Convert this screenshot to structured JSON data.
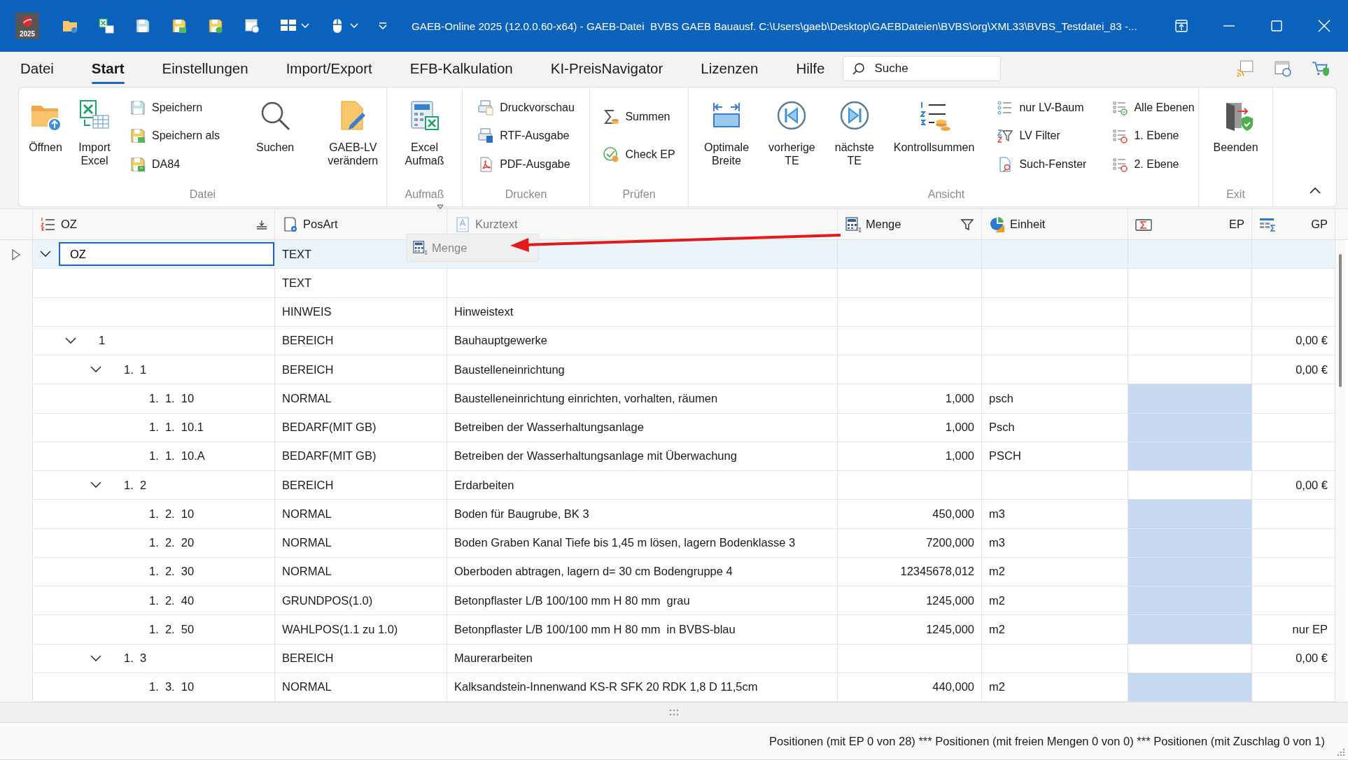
{
  "title_bar": {
    "app_icon_label": "2025",
    "title": "GAEB-Online 2025 (12.0.0.60-x64) - GAEB-Datei  BVBS GAEB Bauausf. C:\\Users\\gaeb\\Desktop\\GAEBDateien\\BVBS\\org\\XML33\\BVBS_Testdatei_83 -..."
  },
  "menu_tabs": [
    {
      "label": "Datei",
      "selected": false
    },
    {
      "label": "Start",
      "selected": true
    },
    {
      "label": "Einstellungen",
      "selected": false
    },
    {
      "label": "Import/Export",
      "selected": false
    },
    {
      "label": "EFB-Kalkulation",
      "selected": false
    },
    {
      "label": "KI-PreisNavigator",
      "selected": false
    },
    {
      "label": "Lizenzen",
      "selected": false
    },
    {
      "label": "Hilfe",
      "selected": false
    }
  ],
  "search": {
    "placeholder": "Suche"
  },
  "ribbon": {
    "groups": [
      {
        "label": "Datei",
        "launcher": false,
        "items": [
          {
            "kind": "large",
            "label": "Öffnen"
          },
          {
            "kind": "large",
            "label": "Import\nExcel"
          },
          {
            "kind": "stack",
            "items": [
              {
                "label": "Speichern"
              },
              {
                "label": "Speichern als"
              },
              {
                "label": "DA84"
              }
            ]
          },
          {
            "kind": "separator"
          },
          {
            "kind": "large",
            "label": "Suchen"
          },
          {
            "kind": "separator"
          },
          {
            "kind": "large",
            "label": "GAEB-LV\nverändern"
          }
        ]
      },
      {
        "label": "Aufmaß",
        "launcher": true,
        "items": [
          {
            "kind": "large",
            "label": "Excel\nAufmaß"
          }
        ]
      },
      {
        "label": "Drucken",
        "launcher": false,
        "items": [
          {
            "kind": "stack",
            "items": [
              {
                "label": "Druckvorschau"
              },
              {
                "label": "RTF-Ausgabe"
              },
              {
                "label": "PDF-Ausgabe"
              }
            ]
          }
        ]
      },
      {
        "label": "Prüfen",
        "launcher": false,
        "items": [
          {
            "kind": "stack",
            "items": [
              {
                "label": "Summen"
              },
              {
                "label": "Check EP"
              }
            ]
          }
        ]
      },
      {
        "label": "Ansicht",
        "launcher": false,
        "items": [
          {
            "kind": "large",
            "label": "Optimale\nBreite"
          },
          {
            "kind": "large",
            "label": "vorherige\nTE"
          },
          {
            "kind": "large",
            "label": "nächste\nTE"
          },
          {
            "kind": "large",
            "label": "Kontrollsummen"
          },
          {
            "kind": "stack",
            "items": [
              {
                "label": "nur LV-Baum"
              },
              {
                "label": "LV Filter"
              },
              {
                "label": "Such-Fenster"
              }
            ]
          },
          {
            "kind": "stack",
            "items": [
              {
                "label": "Alle Ebenen"
              },
              {
                "label": "1. Ebene"
              },
              {
                "label": "2. Ebene"
              }
            ]
          }
        ]
      },
      {
        "label": "Exit",
        "launcher": false,
        "items": [
          {
            "kind": "large",
            "label": "Beenden"
          }
        ]
      }
    ]
  },
  "table": {
    "columns": [
      {
        "label": "OZ",
        "dimmed": false
      },
      {
        "label": "PosArt",
        "dimmed": false
      },
      {
        "label": "Kurztext",
        "dimmed": true
      },
      {
        "label": "Menge",
        "dimmed": false
      },
      {
        "label": "Einheit",
        "dimmed": false
      },
      {
        "label": "EP",
        "dimmed": false
      },
      {
        "label": "GP",
        "dimmed": false
      }
    ],
    "drag_ghost": {
      "label": "Menge"
    },
    "rows": [
      {
        "oz": "OZ",
        "posart": "TEXT",
        "selected": true,
        "expanded": true,
        "ep_marked": false,
        "children": [
          {
            "posart": "TEXT",
            "selected": false,
            "ep_marked": false
          },
          {
            "posart": "HINWEIS",
            "kurztext": "Hinweistext",
            "selected": false,
            "ep_marked": false
          },
          {
            "oz": "1",
            "posart": "BEREICH",
            "kurztext": "Bauhauptgewerke",
            "gp": "0,00 €",
            "selected": false,
            "expanded": true,
            "ep_marked": false,
            "children": [
              {
                "oz": "1.  1",
                "posart": "BEREICH",
                "kurztext": "Baustelleneinrichtung",
                "gp": "0,00 €",
                "selected": false,
                "expanded": true,
                "ep_marked": false,
                "children": [
                  {
                    "oz": "1.  1.  10",
                    "posart": "NORMAL",
                    "kurztext": "Baustelleneinrichtung einrichten, vorhalten, räumen",
                    "menge": "1,000",
                    "einheit": "psch",
                    "selected": false,
                    "ep_marked": true
                  },
                  {
                    "oz": "1.  1.  10.1",
                    "posart": "BEDARF(MIT GB)",
                    "kurztext": "Betreiben der Wasserhaltungsanlage",
                    "menge": "1,000",
                    "einheit": "Psch",
                    "selected": false,
                    "ep_marked": true
                  },
                  {
                    "oz": "1.  1.  10.A",
                    "posart": "BEDARF(MIT GB)",
                    "kurztext": "Betreiben der Wasserhaltungsanlage mit Überwachung",
                    "menge": "1,000",
                    "einheit": "PSCH",
                    "selected": false,
                    "ep_marked": true
                  }
                ]
              },
              {
                "oz": "1.  2",
                "posart": "BEREICH",
                "kurztext": "Erdarbeiten",
                "gp": "0,00 €",
                "selected": false,
                "expanded": true,
                "ep_marked": false,
                "children": [
                  {
                    "oz": "1.  2.  10",
                    "posart": "NORMAL",
                    "kurztext": "Boden für Baugrube, BK 3",
                    "menge": "450,000",
                    "einheit": "m3",
                    "selected": false,
                    "ep_marked": true
                  },
                  {
                    "oz": "1.  2.  20",
                    "posart": "NORMAL",
                    "kurztext": "Boden Graben Kanal Tiefe bis 1,45 m lösen, lagern Bodenklasse 3",
                    "menge": "7200,000",
                    "einheit": "m3",
                    "selected": false,
                    "ep_marked": true
                  },
                  {
                    "oz": "1.  2.  30",
                    "posart": "NORMAL",
                    "kurztext": "Oberboden abtragen, lagern d= 30 cm Bodengruppe 4",
                    "menge": "12345678,012",
                    "einheit": "m2",
                    "selected": false,
                    "ep_marked": true
                  },
                  {
                    "oz": "1.  2.  40",
                    "posart": "GRUNDPOS(1.0)",
                    "kurztext": "Betonpflaster L/B 100/100 mm H 80 mm  grau",
                    "menge": "1245,000",
                    "einheit": "m2",
                    "selected": false,
                    "ep_marked": true
                  },
                  {
                    "oz": "1.  2.  50",
                    "posart": "WAHLPOS(1.1 zu 1.0)",
                    "kurztext": "Betonpflaster L/B 100/100 mm H 80 mm  in BVBS-blau",
                    "menge": "1245,000",
                    "einheit": "m2",
                    "gp": "nur EP",
                    "selected": false,
                    "ep_marked": true
                  }
                ]
              },
              {
                "oz": "1.  3",
                "posart": "BEREICH",
                "kurztext": "Maurerarbeiten",
                "gp": "0,00 €",
                "selected": false,
                "expanded": true,
                "ep_marked": false,
                "children": [
                  {
                    "oz": "1.  3.  10",
                    "posart": "NORMAL",
                    "kurztext": "Kalksandstein-Innenwand KS-R SFK 20 RDK 1,8 D 11,5cm",
                    "menge": "440,000",
                    "einheit": "m2",
                    "selected": false,
                    "ep_marked": true
                  }
                ]
              }
            ]
          }
        ]
      }
    ]
  },
  "status_bar": {
    "text": "Positionen (mit EP 0 von 28) *** Positionen (mit freien Mengen 0 von 0) *** Positionen (mit Zuschlag 0 von 1)"
  }
}
